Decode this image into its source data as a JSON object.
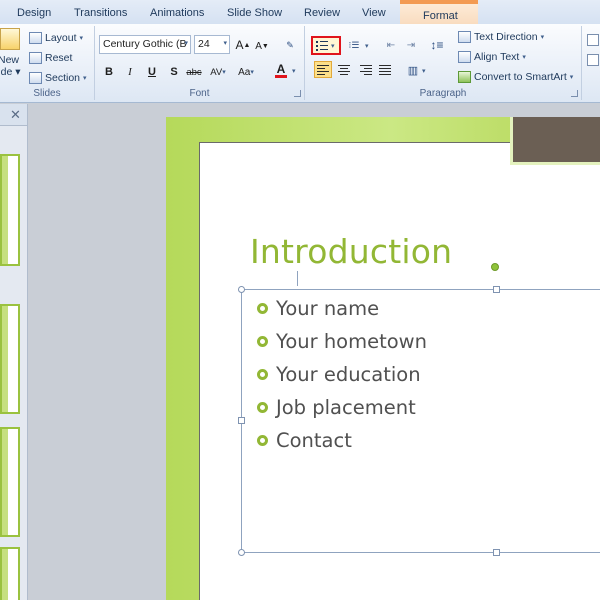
{
  "tabs": [
    "Design",
    "Transitions",
    "Animations",
    "Slide Show",
    "Review",
    "View",
    "Format"
  ],
  "ribbon": {
    "slides_group": {
      "label": "Slides",
      "new_slide_top": "New",
      "new_slide_bottom": "lide ▾",
      "layout": "Layout",
      "reset": "Reset",
      "section": "Section"
    },
    "font_group": {
      "label": "Font",
      "font_name": "Century Gothic (B",
      "font_size": "24",
      "grow": "A",
      "shrink": "A",
      "bold": "B",
      "italic": "I",
      "underline": "U",
      "shadow": "S",
      "strike": "abc",
      "spacing": "AV",
      "case": "Aa",
      "color": "A"
    },
    "paragraph_group": {
      "label": "Paragraph",
      "text_direction": "Text Direction",
      "align_text": "Align Text",
      "convert_smartart": "Convert to SmartArt"
    }
  },
  "panel": {
    "close": "✕"
  },
  "slide": {
    "title": "Introduction",
    "bullets": [
      "Your name",
      "Your hometown",
      "Your education",
      "Job placement",
      "Contact"
    ]
  },
  "colors": {
    "accent_green": "#92b735",
    "highlight_red": "#e0141c",
    "dark_box": "#6b5f54"
  }
}
